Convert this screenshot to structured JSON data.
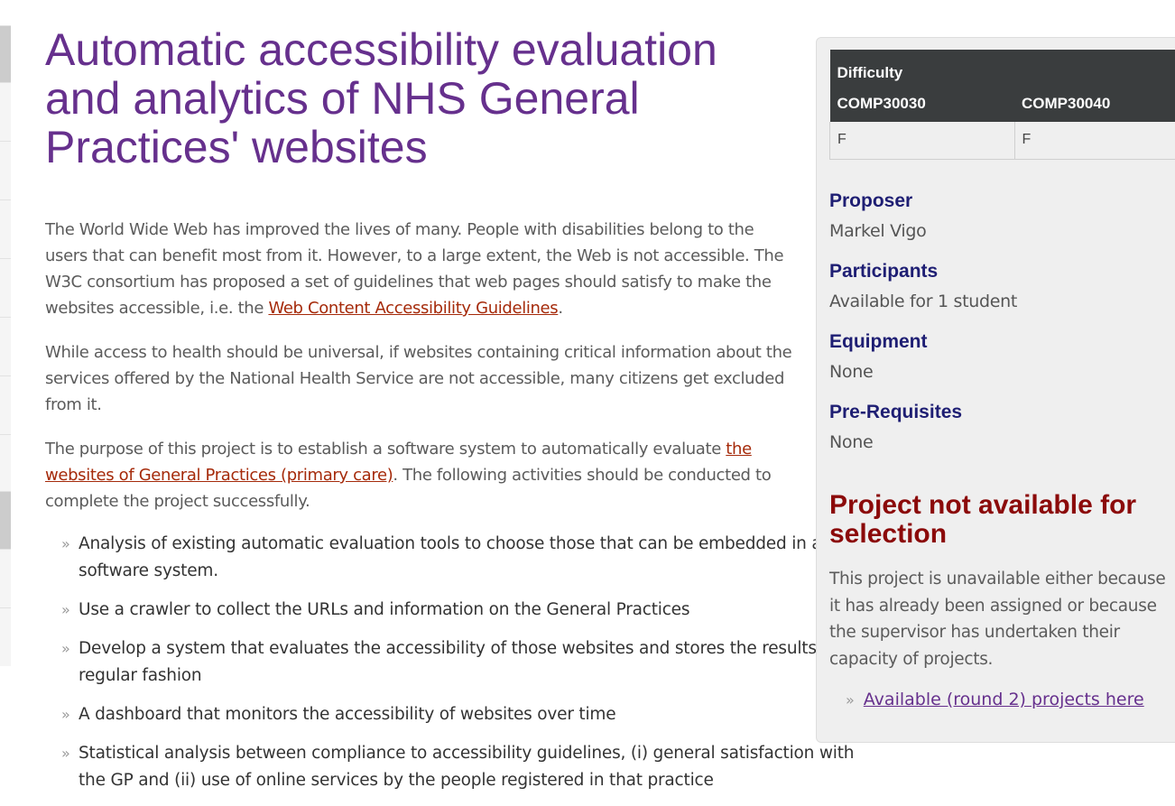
{
  "main": {
    "title": "Automatic accessibility evaluation and analytics of NHS General Practices' websites",
    "paragraphs": [
      {
        "before": "The World Wide Web has improved the lives of many. People with disabilities belong to the users that can benefit most from it. However, to a large extent, the Web is not accessible. The W3C consortium has proposed a set of guidelines that web pages should satisfy to make the websites accessible, i.e. the ",
        "link": "Web Content Accessibility Guidelines",
        "after": "."
      },
      {
        "text": "While access to health should be universal, if websites containing critical information about the services offered by the National Health Service are not accessible, many citizens get excluded from it."
      },
      {
        "before": "The purpose of this project is to establish a software system to automatically evaluate ",
        "link": "the websites of General Practices (primary care)",
        "after": ". The following activities should be conducted to complete the project successfully."
      }
    ],
    "bullet_glyph": "»",
    "activities": [
      "Analysis of existing automatic evaluation tools to choose those that can be embedded in a software system.",
      "Use a crawler to collect the URLs and information on the General Practices",
      "Develop a system that evaluates the accessibility of those websites and stores the results in a regular fashion",
      "A dashboard that monitors the accessibility of websites over time",
      "Statistical analysis between compliance to accessibility guidelines, (i) general satisfaction with the GP and (ii) use of online services by the people registered in that practice"
    ]
  },
  "sidebar": {
    "difficulty": {
      "title": "Difficulty",
      "columns": [
        "COMP30030",
        "COMP30040"
      ],
      "values": [
        "F",
        "F"
      ]
    },
    "proposer_label": "Proposer",
    "proposer_value": "Markel Vigo",
    "participants_label": "Participants",
    "participants_value": "Available for 1 student",
    "equipment_label": "Equipment",
    "equipment_value": "None",
    "prereq_label": "Pre-Requisites",
    "prereq_value": "None",
    "unavailable_heading": "Project not available for selection",
    "unavailable_text": "This project is unavailable either because it has already been assigned or because the supervisor has undertaken their capacity of projects.",
    "round2_link": "Available (round 2) projects here"
  },
  "colors": {
    "title": "#66308d",
    "link": "#a52a0a",
    "sidebar_label": "#1e1e73",
    "unavailable": "#8b0a0a",
    "table_header": "#3a3d3e"
  }
}
